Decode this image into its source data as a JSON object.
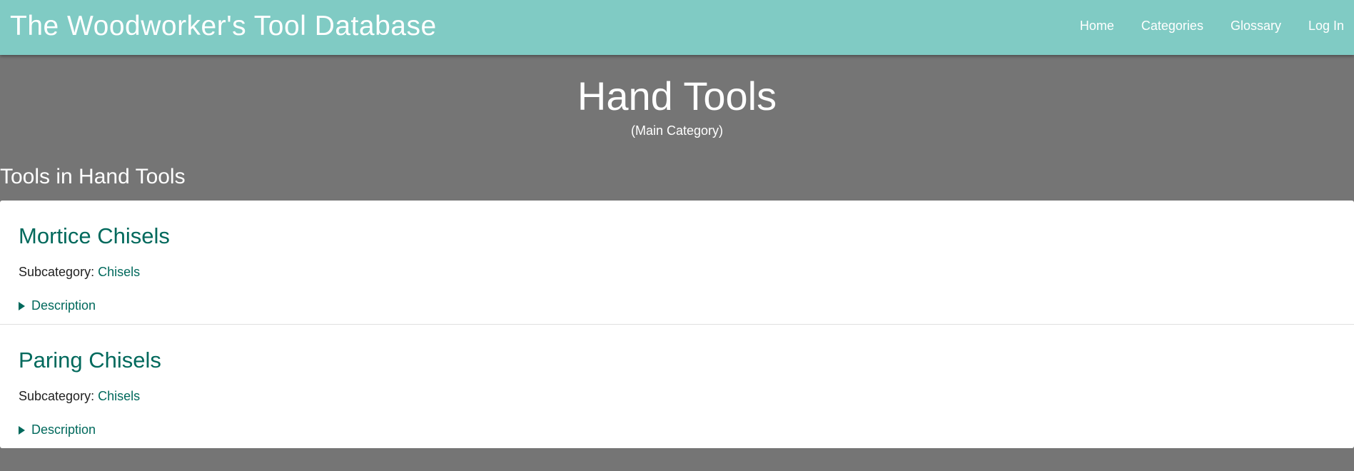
{
  "header": {
    "brand": "The Woodworker's Tool Database",
    "nav": [
      {
        "label": "Home"
      },
      {
        "label": "Categories"
      },
      {
        "label": "Glossary"
      },
      {
        "label": "Log In"
      }
    ]
  },
  "hero": {
    "title": "Hand Tools",
    "subtitle": "(Main Category)"
  },
  "section": {
    "heading": "Tools in Hand Tools"
  },
  "tools": [
    {
      "name": "Mortice Chisels",
      "subcategory_label": "Subcategory:",
      "subcategory_value": "Chisels",
      "description_label": "Description"
    },
    {
      "name": "Paring Chisels",
      "subcategory_label": "Subcategory:",
      "subcategory_value": "Chisels",
      "description_label": "Description"
    }
  ],
  "colors": {
    "navbar": "#80cbc4",
    "page_bg": "#757575",
    "accent": "#00695c"
  }
}
